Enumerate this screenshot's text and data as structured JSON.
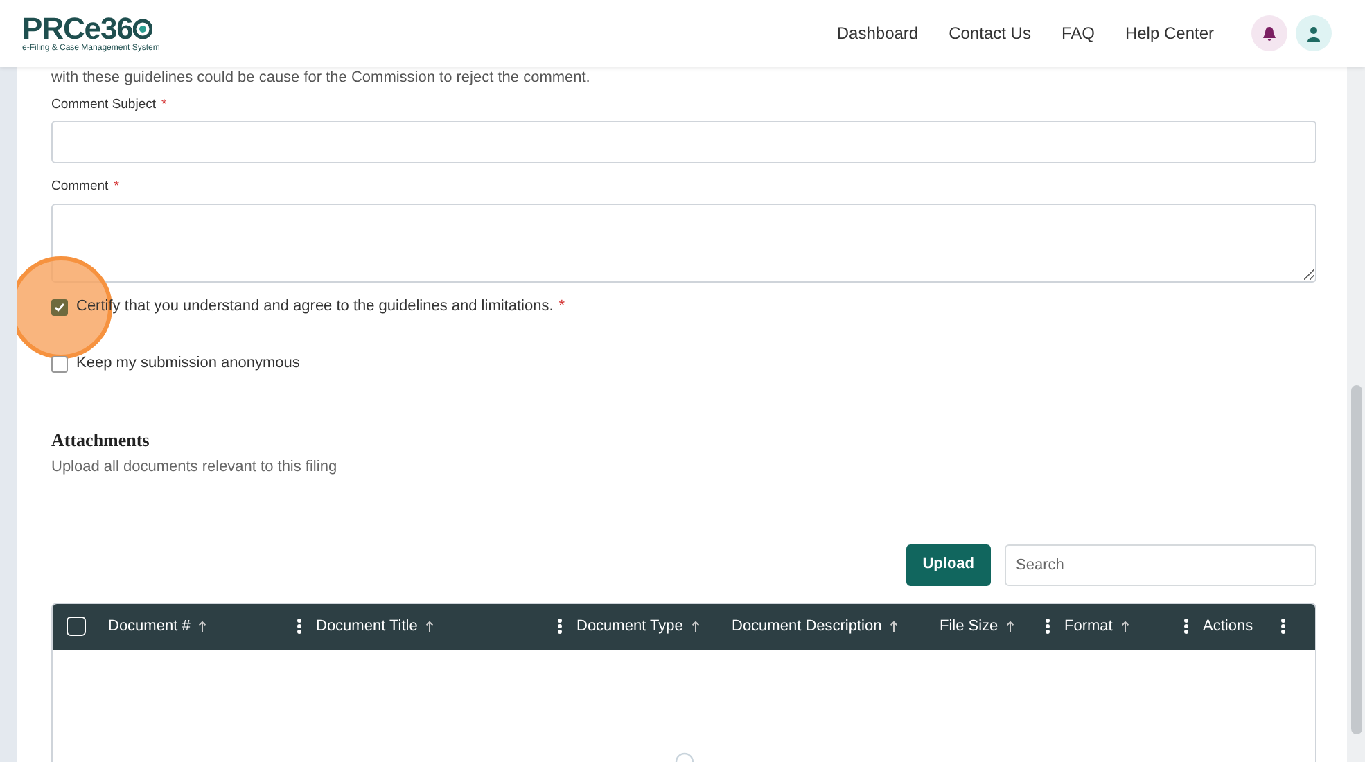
{
  "header": {
    "logo": {
      "name": "PRCe36",
      "tagline": "e-Filing & Case Management System"
    },
    "nav": [
      {
        "label": "Dashboard"
      },
      {
        "label": "Contact Us"
      },
      {
        "label": "FAQ"
      },
      {
        "label": "Help Center"
      }
    ]
  },
  "intro_text": "with these guidelines could be cause for the Commission to reject the comment.",
  "fields": [
    {
      "label": "Comment Subject",
      "required_mark": "*",
      "kind": "input"
    },
    {
      "label": "Comment",
      "required_mark": "*",
      "kind": "textarea"
    }
  ],
  "checkboxes": [
    {
      "label": "Certify that you understand and agree to the guidelines and limitations.",
      "required_mark": "*",
      "checked": true,
      "highlighted": true
    },
    {
      "label": "Keep my submission anonymous",
      "checked": false,
      "highlighted": false
    }
  ],
  "attachments": {
    "title": "Attachments",
    "subtitle": "Upload all documents relevant to this filing",
    "upload_button": "Upload",
    "search": {
      "placeholder": "Search"
    },
    "select_all_checked": false,
    "columns": [
      {
        "label": "Document #",
        "sort": true,
        "menu": true
      },
      {
        "label": "Document Title",
        "sort": true,
        "menu": true
      },
      {
        "label": "Document Type",
        "sort": true,
        "menu": false
      },
      {
        "label": "Document Description",
        "sort": true,
        "menu": false
      },
      {
        "label": "File Size",
        "sort": true,
        "menu": true
      },
      {
        "label": "Format",
        "sort": true,
        "menu": true
      },
      {
        "label": "Actions",
        "sort": false,
        "menu": true
      }
    ],
    "loading": true
  }
}
